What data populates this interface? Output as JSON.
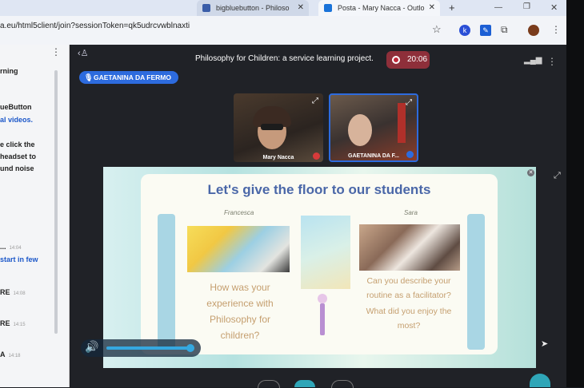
{
  "browser": {
    "tabs": [
      {
        "label": "bigbluebutton - Philoso",
        "active": false
      },
      {
        "label": "Posta - Mary Nacca - Outlo",
        "active": true
      }
    ],
    "new_tab": "+",
    "url": "a.eu/html5client/join?sessionToken=qk5udrcvwblnaxti",
    "profile_letter": "k"
  },
  "chat": {
    "lines": [
      {
        "text": "rning",
        "color": "dark"
      },
      {
        "text": "ueButton",
        "color": "dark"
      },
      {
        "text": "al videos.",
        "color": "blue"
      },
      {
        "text": "e click the",
        "color": "dark"
      },
      {
        "text": "headset to",
        "color": "dark"
      },
      {
        "text": "und noise",
        "color": "dark"
      }
    ],
    "messages": [
      {
        "text": "...",
        "time": "14:04"
      },
      {
        "text": "start in few",
        "time": ""
      },
      {
        "text": "RE",
        "time": "14:08"
      },
      {
        "text": "RE",
        "time": "14:15"
      },
      {
        "text": "A",
        "time": "14:18"
      }
    ]
  },
  "meeting": {
    "title": "Philosophy for Children: a service learning project.",
    "recording_time": "20:06",
    "talking_indicator": "GAETANINA DA FERMO",
    "videos": [
      {
        "name": "Mary Nacca"
      },
      {
        "name": "GAETANINA DA F..."
      }
    ]
  },
  "slide": {
    "headline": "Let's give the floor to our students",
    "left_name": "Francesca",
    "left_question": "How was your experience with Philosophy for children?",
    "right_name": "Sara",
    "right_question_1": "Can you describe your routine as a facilitator?",
    "right_question_2": "What did you enjoy the most?"
  },
  "volume": {
    "level": 0.95
  }
}
